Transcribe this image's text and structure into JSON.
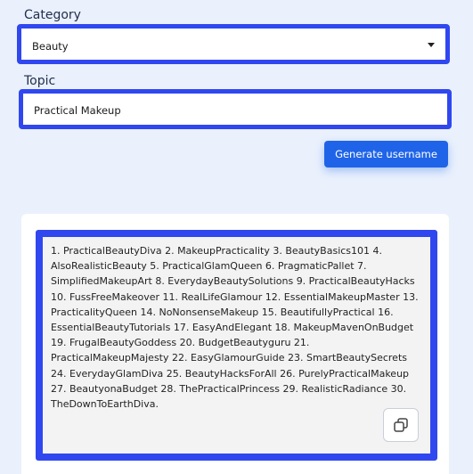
{
  "category": {
    "label": "Category",
    "selected": "Beauty"
  },
  "topic": {
    "label": "Topic",
    "value": "Practical Makeup"
  },
  "generate_button": {
    "label": "Generate username"
  },
  "result": {
    "text": "1. PracticalBeautyDiva 2. MakeupPracticality 3. BeautyBasics101 4. AlsoRealisticBeauty 5. PracticalGlamQueen 6. PragmaticPallet 7. SimplifiedMakeupArt 8. EverydayBeautySolutions 9. PracticalBeautyHacks 10. FussFreeMakeover 11. RealLifeGlamour 12. EssentialMakeupMaster 13. PracticalityQueen 14. NoNonsenseMakeup 15. BeautifullyPractical 16. EssentialBeautyTutorials 17. EasyAndElegant 18. MakeupMavenOnBudget 19. FrugalBeautyGoddess 20. BudgetBeautyguru 21. PracticalMakeupMajesty 22. EasyGlamourGuide 23. SmartBeautySecrets 24. EverydayGlamDiva 25. BeautyHacksForAll 26. PurelyPracticalMakeup 27. BeautyonaBudget 28. ThePracticalPrincess 29. RealisticRadiance 30. TheDownToEarthDiva.",
    "copy_icon": "copy-icon"
  },
  "colors": {
    "page_bg": "#eaf1fd",
    "highlight_border": "#3047f0",
    "primary_button": "#1f64e8"
  }
}
